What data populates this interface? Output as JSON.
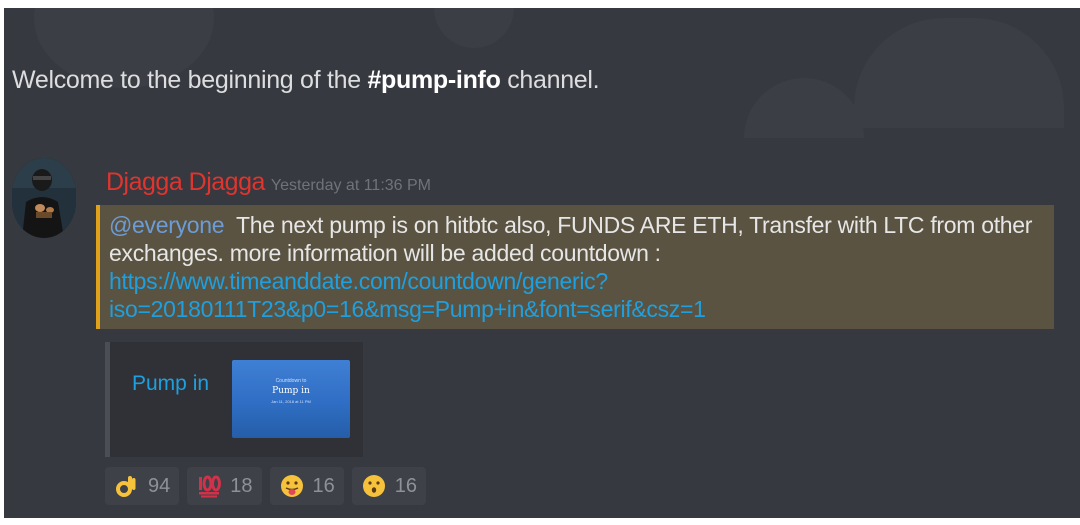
{
  "channel": {
    "welcome_prefix": "Welcome to the beginning of the ",
    "channel_name": "#pump-info",
    "welcome_suffix": " channel."
  },
  "message": {
    "author": "Djagga Djagga",
    "timestamp": "Yesterday at 11:36 PM",
    "mention": "@everyone",
    "text": "  The next pump is on hitbtc also, FUNDS ARE ETH, Transfer with LTC from other exchanges. more information will be added countdown :",
    "link_line1": "https://www.timeanddate.com/countdown/generic?",
    "link_line2": "iso=20180111T23&p0=16&msg=Pump+in&font=serif&csz=1"
  },
  "embed": {
    "title": "Pump in",
    "thumb_small": "Countdown to",
    "thumb_title": "Pump in",
    "thumb_date": "Jan 11, 2018 at 11 PM"
  },
  "reactions": [
    {
      "emoji": "ok-hand-icon",
      "count": "94"
    },
    {
      "emoji": "hundred-points-icon",
      "count": "18"
    },
    {
      "emoji": "tongue-face-icon",
      "count": "16"
    },
    {
      "emoji": "kissing-face-icon",
      "count": "16"
    }
  ],
  "colors": {
    "background": "#36393f",
    "username": "#e0342e",
    "mention_highlight": "#5a5341",
    "mention_border": "#e0a21a",
    "link": "#1ea0e0"
  }
}
